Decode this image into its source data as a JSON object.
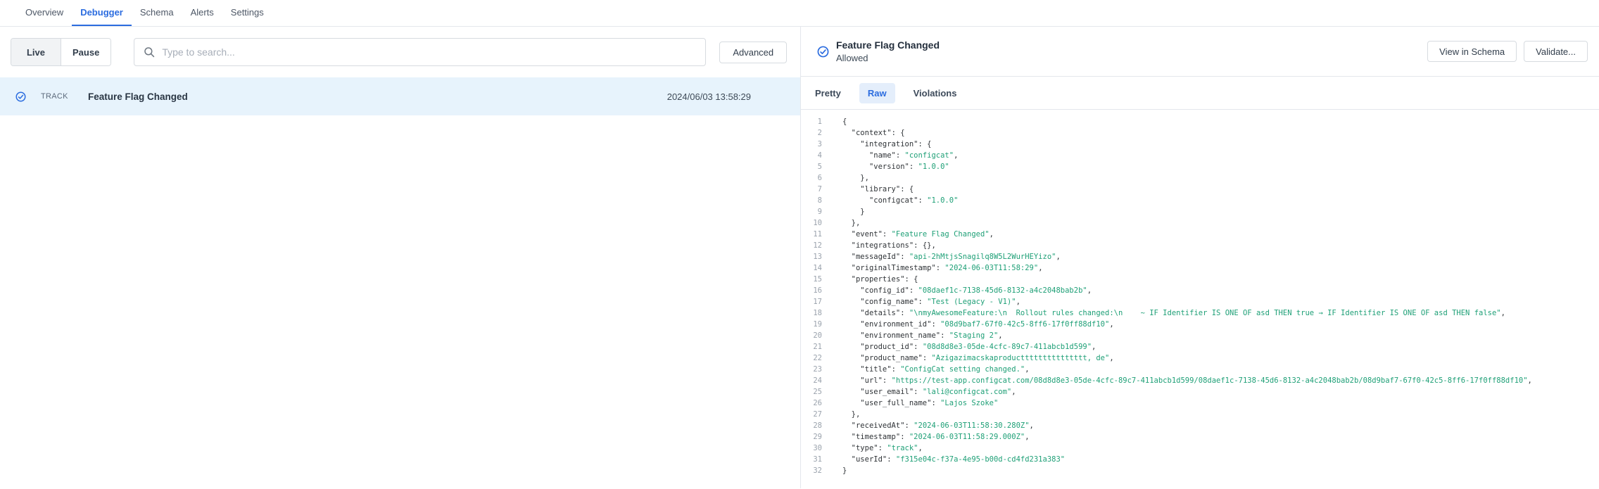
{
  "nav": {
    "tabs": [
      {
        "label": "Overview"
      },
      {
        "label": "Debugger"
      },
      {
        "label": "Schema"
      },
      {
        "label": "Alerts"
      },
      {
        "label": "Settings"
      }
    ],
    "active_tab": "Debugger"
  },
  "toolbar": {
    "live_label": "Live",
    "pause_label": "Pause",
    "search_placeholder": "Type to search...",
    "advanced_label": "Advanced"
  },
  "event_list": {
    "rows": [
      {
        "icon": "check-circle-icon",
        "type": "TRACK",
        "name": "Feature Flag Changed",
        "timestamp": "2024/06/03 13:58:29",
        "selected": true
      }
    ]
  },
  "detail": {
    "icon": "check-circle-icon",
    "title": "Feature Flag Changed",
    "status": "Allowed",
    "buttons": {
      "view_in_schema": "View in Schema",
      "validate": "Validate..."
    },
    "tabs": [
      {
        "label": "Pretty"
      },
      {
        "label": "Raw"
      },
      {
        "label": "Violations"
      }
    ],
    "active_tab": "Raw"
  },
  "colors": {
    "accent_blue": "#2b6cdf",
    "selected_row_bg": "#e7f3fc",
    "string_green": "#1fa077",
    "line_number_gray": "#9aa2ac"
  },
  "code": {
    "lines": [
      [
        [
          "pu",
          "{"
        ]
      ],
      [
        [
          "pu",
          "  "
        ],
        [
          "k",
          "\"context\""
        ],
        [
          "pu",
          ": {"
        ]
      ],
      [
        [
          "pu",
          "    "
        ],
        [
          "k",
          "\"integration\""
        ],
        [
          "pu",
          ": {"
        ]
      ],
      [
        [
          "pu",
          "      "
        ],
        [
          "k",
          "\"name\""
        ],
        [
          "pu",
          ": "
        ],
        [
          "st",
          "\"configcat\""
        ],
        [
          "pu",
          ","
        ]
      ],
      [
        [
          "pu",
          "      "
        ],
        [
          "k",
          "\"version\""
        ],
        [
          "pu",
          ": "
        ],
        [
          "st",
          "\"1.0.0\""
        ]
      ],
      [
        [
          "pu",
          "    },"
        ]
      ],
      [
        [
          "pu",
          "    "
        ],
        [
          "k",
          "\"library\""
        ],
        [
          "pu",
          ": {"
        ]
      ],
      [
        [
          "pu",
          "      "
        ],
        [
          "k",
          "\"configcat\""
        ],
        [
          "pu",
          ": "
        ],
        [
          "st",
          "\"1.0.0\""
        ]
      ],
      [
        [
          "pu",
          "    }"
        ]
      ],
      [
        [
          "pu",
          "  },"
        ]
      ],
      [
        [
          "pu",
          "  "
        ],
        [
          "k",
          "\"event\""
        ],
        [
          "pu",
          ": "
        ],
        [
          "st",
          "\"Feature Flag Changed\""
        ],
        [
          "pu",
          ","
        ]
      ],
      [
        [
          "pu",
          "  "
        ],
        [
          "k",
          "\"integrations\""
        ],
        [
          "pu",
          ": {},"
        ]
      ],
      [
        [
          "pu",
          "  "
        ],
        [
          "k",
          "\"messageId\""
        ],
        [
          "pu",
          ": "
        ],
        [
          "st",
          "\"api-2hMtjsSnagilq8W5L2WurHEYizo\""
        ],
        [
          "pu",
          ","
        ]
      ],
      [
        [
          "pu",
          "  "
        ],
        [
          "k",
          "\"originalTimestamp\""
        ],
        [
          "pu",
          ": "
        ],
        [
          "st",
          "\"2024-06-03T11:58:29\""
        ],
        [
          "pu",
          ","
        ]
      ],
      [
        [
          "pu",
          "  "
        ],
        [
          "k",
          "\"properties\""
        ],
        [
          "pu",
          ": {"
        ]
      ],
      [
        [
          "pu",
          "    "
        ],
        [
          "k",
          "\"config_id\""
        ],
        [
          "pu",
          ": "
        ],
        [
          "st",
          "\"08daef1c-7138-45d6-8132-a4c2048bab2b\""
        ],
        [
          "pu",
          ","
        ]
      ],
      [
        [
          "pu",
          "    "
        ],
        [
          "k",
          "\"config_name\""
        ],
        [
          "pu",
          ": "
        ],
        [
          "st",
          "\"Test (Legacy - V1)\""
        ],
        [
          "pu",
          ","
        ]
      ],
      [
        [
          "pu",
          "    "
        ],
        [
          "k",
          "\"details\""
        ],
        [
          "pu",
          ": "
        ],
        [
          "st",
          "\"\\nmyAwesomeFeature:\\n  Rollout rules changed:\\n    ~ IF Identifier IS ONE OF asd THEN true → IF Identifier IS ONE OF asd THEN false\""
        ],
        [
          "pu",
          ","
        ]
      ],
      [
        [
          "pu",
          "    "
        ],
        [
          "k",
          "\"environment_id\""
        ],
        [
          "pu",
          ": "
        ],
        [
          "st",
          "\"08d9baf7-67f0-42c5-8ff6-17f0ff88df10\""
        ],
        [
          "pu",
          ","
        ]
      ],
      [
        [
          "pu",
          "    "
        ],
        [
          "k",
          "\"environment_name\""
        ],
        [
          "pu",
          ": "
        ],
        [
          "st",
          "\"Staging 2\""
        ],
        [
          "pu",
          ","
        ]
      ],
      [
        [
          "pu",
          "    "
        ],
        [
          "k",
          "\"product_id\""
        ],
        [
          "pu",
          ": "
        ],
        [
          "st",
          "\"08d8d8e3-05de-4cfc-89c7-411abcb1d599\""
        ],
        [
          "pu",
          ","
        ]
      ],
      [
        [
          "pu",
          "    "
        ],
        [
          "k",
          "\"product_name\""
        ],
        [
          "pu",
          ": "
        ],
        [
          "st",
          "\"Azigazimacskaproducttttttttttttttt, de\""
        ],
        [
          "pu",
          ","
        ]
      ],
      [
        [
          "pu",
          "    "
        ],
        [
          "k",
          "\"title\""
        ],
        [
          "pu",
          ": "
        ],
        [
          "st",
          "\"ConfigCat setting changed.\""
        ],
        [
          "pu",
          ","
        ]
      ],
      [
        [
          "pu",
          "    "
        ],
        [
          "k",
          "\"url\""
        ],
        [
          "pu",
          ": "
        ],
        [
          "st",
          "\"https://test-app.configcat.com/08d8d8e3-05de-4cfc-89c7-411abcb1d599/08daef1c-7138-45d6-8132-a4c2048bab2b/08d9baf7-67f0-42c5-8ff6-17f0ff88df10\""
        ],
        [
          "pu",
          ","
        ]
      ],
      [
        [
          "pu",
          "    "
        ],
        [
          "k",
          "\"user_email\""
        ],
        [
          "pu",
          ": "
        ],
        [
          "st",
          "\"lali@configcat.com\""
        ],
        [
          "pu",
          ","
        ]
      ],
      [
        [
          "pu",
          "    "
        ],
        [
          "k",
          "\"user_full_name\""
        ],
        [
          "pu",
          ": "
        ],
        [
          "st",
          "\"Lajos Szoke\""
        ]
      ],
      [
        [
          "pu",
          "  },"
        ]
      ],
      [
        [
          "pu",
          "  "
        ],
        [
          "k",
          "\"receivedAt\""
        ],
        [
          "pu",
          ": "
        ],
        [
          "st",
          "\"2024-06-03T11:58:30.280Z\""
        ],
        [
          "pu",
          ","
        ]
      ],
      [
        [
          "pu",
          "  "
        ],
        [
          "k",
          "\"timestamp\""
        ],
        [
          "pu",
          ": "
        ],
        [
          "st",
          "\"2024-06-03T11:58:29.000Z\""
        ],
        [
          "pu",
          ","
        ]
      ],
      [
        [
          "pu",
          "  "
        ],
        [
          "k",
          "\"type\""
        ],
        [
          "pu",
          ": "
        ],
        [
          "st",
          "\"track\""
        ],
        [
          "pu",
          ","
        ]
      ],
      [
        [
          "pu",
          "  "
        ],
        [
          "k",
          "\"userId\""
        ],
        [
          "pu",
          ": "
        ],
        [
          "st",
          "\"f315e04c-f37a-4e95-b00d-cd4fd231a383\""
        ]
      ],
      [
        [
          "pu",
          "}"
        ]
      ]
    ]
  }
}
